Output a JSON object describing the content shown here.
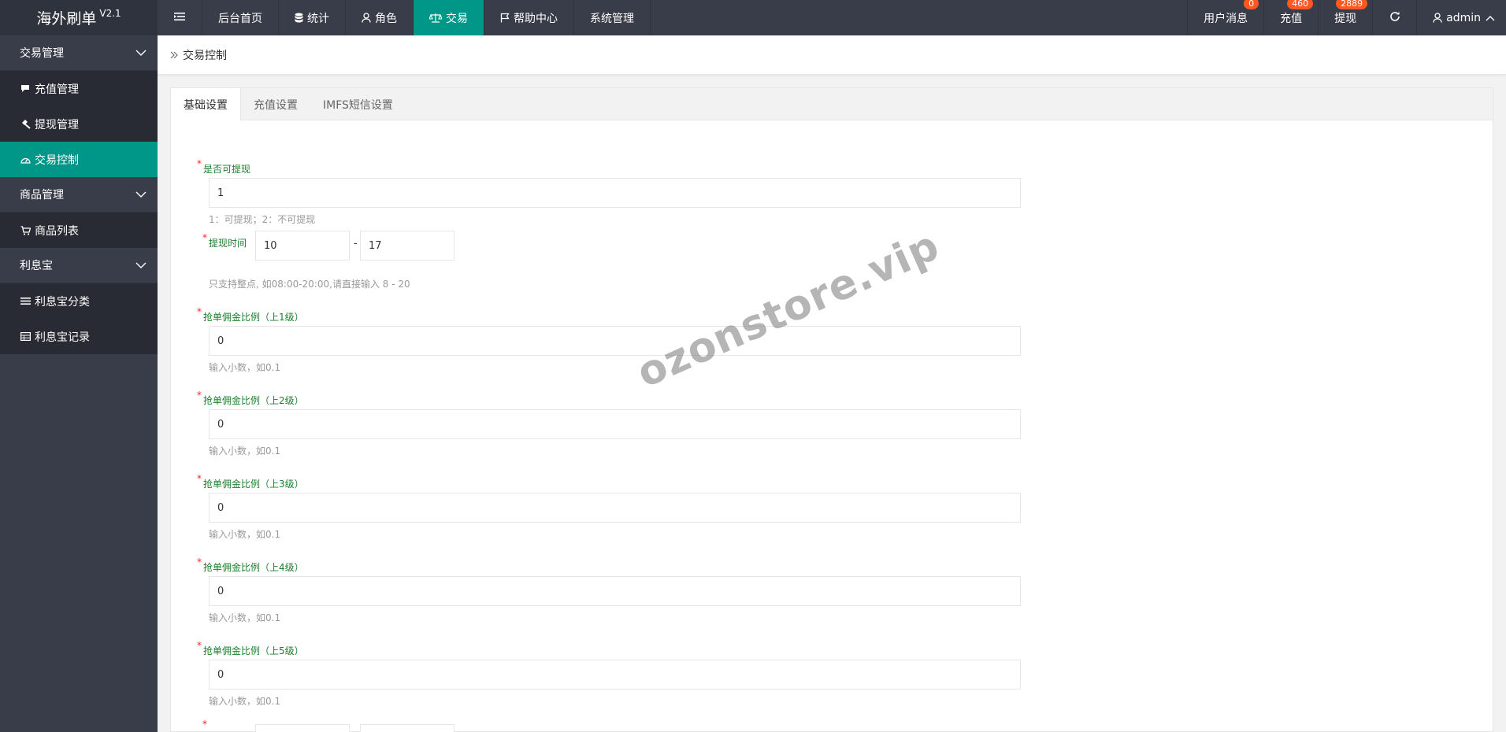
{
  "app": {
    "title": "海外刷单",
    "version": "V2.1"
  },
  "nav": {
    "items": [
      {
        "label": "后台首页",
        "icon": ""
      },
      {
        "label": "统计",
        "icon": "database-icon"
      },
      {
        "label": "角色",
        "icon": "user-icon"
      },
      {
        "label": "交易",
        "icon": "scale-icon"
      },
      {
        "label": "帮助中心",
        "icon": "flag-icon"
      },
      {
        "label": "系统管理",
        "icon": ""
      }
    ],
    "active": "交易"
  },
  "right_nav": {
    "messages": {
      "label": "用户消息",
      "badge": "0"
    },
    "recharge": {
      "label": "充值",
      "badge": "460"
    },
    "withdraw": {
      "label": "提现",
      "badge": "2889"
    },
    "user": "admin"
  },
  "sidebar": {
    "groups": [
      {
        "label": "交易管理",
        "items": [
          "充值管理",
          "提现管理",
          "交易控制"
        ]
      },
      {
        "label": "商品管理",
        "items": [
          "商品列表"
        ]
      },
      {
        "label": "利息宝",
        "items": [
          "利息宝分类",
          "利息宝记录"
        ]
      }
    ],
    "active_item": "交易控制"
  },
  "breadcrumb": "交易控制",
  "tabs": [
    "基础设置",
    "充值设置",
    "IMFS短信设置"
  ],
  "active_tab": "基础设置",
  "form": {
    "can_withdraw": {
      "label": "是否可提现",
      "value": "1",
      "help": "1：可提现；2：不可提现"
    },
    "withdraw_time": {
      "label": "提现时间",
      "from": "10",
      "separator": "-",
      "to": "17",
      "help": "只支持整点, 如08:00-20:00,请直接输入 8 - 20"
    },
    "commission_1": {
      "label": "抢单佣金比例（上1级）",
      "value": "0",
      "help": "输入小数，如0.1"
    },
    "commission_2": {
      "label": "抢单佣金比例（上2级）",
      "value": "0",
      "help": "输入小数，如0.1"
    },
    "commission_3": {
      "label": "抢单佣金比例（上3级）",
      "value": "0",
      "help": "输入小数，如0.1"
    },
    "commission_4": {
      "label": "抢单佣金比例（上4级）",
      "value": "0",
      "help": "输入小数，如0.1"
    },
    "commission_5": {
      "label": "抢单佣金比例（上5级）",
      "value": "0",
      "help": "输入小数，如0.1"
    }
  },
  "watermark": "ozonstore.vip",
  "colors": {
    "header_bg": "#393d49",
    "accent": "#009688",
    "badge": "#ff5722",
    "label_green": "#1b7f2d"
  }
}
